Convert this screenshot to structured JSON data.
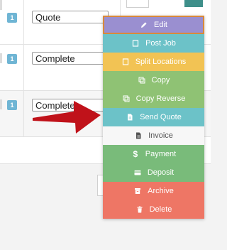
{
  "rows": [
    {
      "badge": "1",
      "status": "Quote"
    },
    {
      "badge": "1",
      "status": "Complete"
    },
    {
      "badge": "1",
      "status": "Complete"
    }
  ],
  "menu": {
    "items": [
      {
        "label": "Edit",
        "icon": "pencil-icon"
      },
      {
        "label": "Post Job",
        "icon": "document-icon"
      },
      {
        "label": "Split Locations",
        "icon": "document-icon"
      },
      {
        "label": "Copy",
        "icon": "copy-icon"
      },
      {
        "label": "Copy Reverse",
        "icon": "copy-icon"
      },
      {
        "label": "Send Quote",
        "icon": "file-icon"
      },
      {
        "label": "Invoice",
        "icon": "file-icon"
      },
      {
        "label": "Payment",
        "icon": "dollar-icon"
      },
      {
        "label": "Deposit",
        "icon": "credit-card-icon"
      },
      {
        "label": "Archive",
        "icon": "archive-icon"
      },
      {
        "label": "Delete",
        "icon": "trash-icon"
      }
    ]
  },
  "colors": {
    "edit": "#9a8fd0",
    "teal": "#6cc2c8",
    "yellow": "#f2c354",
    "green": "#8fc274",
    "red": "#ee7665",
    "arrow": "#c0121a"
  }
}
